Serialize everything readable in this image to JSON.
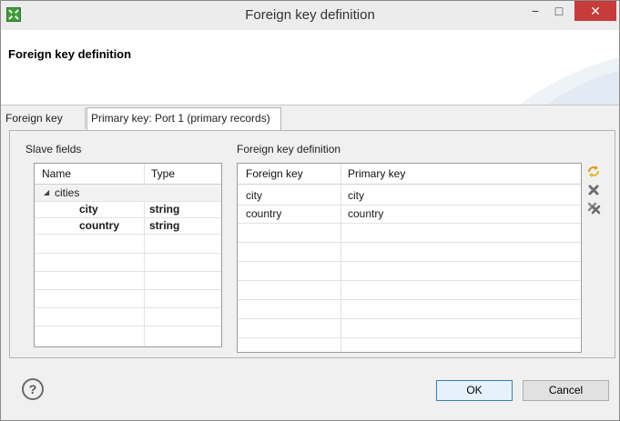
{
  "window": {
    "title": "Foreign key definition",
    "controls": {
      "minimize": "−",
      "maximize": "□",
      "close": "✕"
    }
  },
  "header": {
    "title": "Foreign key definition"
  },
  "tabs": [
    {
      "label": "Foreign key",
      "active": false
    },
    {
      "label": "Primary key: Port 1 (primary records)",
      "active": true
    }
  ],
  "slave_fields": {
    "label": "Slave fields",
    "columns": [
      "Name",
      "Type"
    ],
    "group": {
      "expander": "◢",
      "name": "cities"
    },
    "rows": [
      {
        "name": "city",
        "type": "string"
      },
      {
        "name": "country",
        "type": "string"
      }
    ]
  },
  "fk_definition": {
    "label": "Foreign key definition",
    "columns": [
      "Foreign key",
      "Primary key"
    ],
    "rows": [
      {
        "foreign": "city",
        "primary": "city"
      },
      {
        "foreign": "country",
        "primary": "country"
      }
    ]
  },
  "tools": [
    "auto-map-icon",
    "remove-icon",
    "remove-all-icon"
  ],
  "buttons": {
    "help": "?",
    "ok": "OK",
    "cancel": "Cancel"
  },
  "colors": {
    "close_button": "#c73b3b",
    "app_icon": "#3f9a3c",
    "ok_border": "#3c7fb1"
  }
}
